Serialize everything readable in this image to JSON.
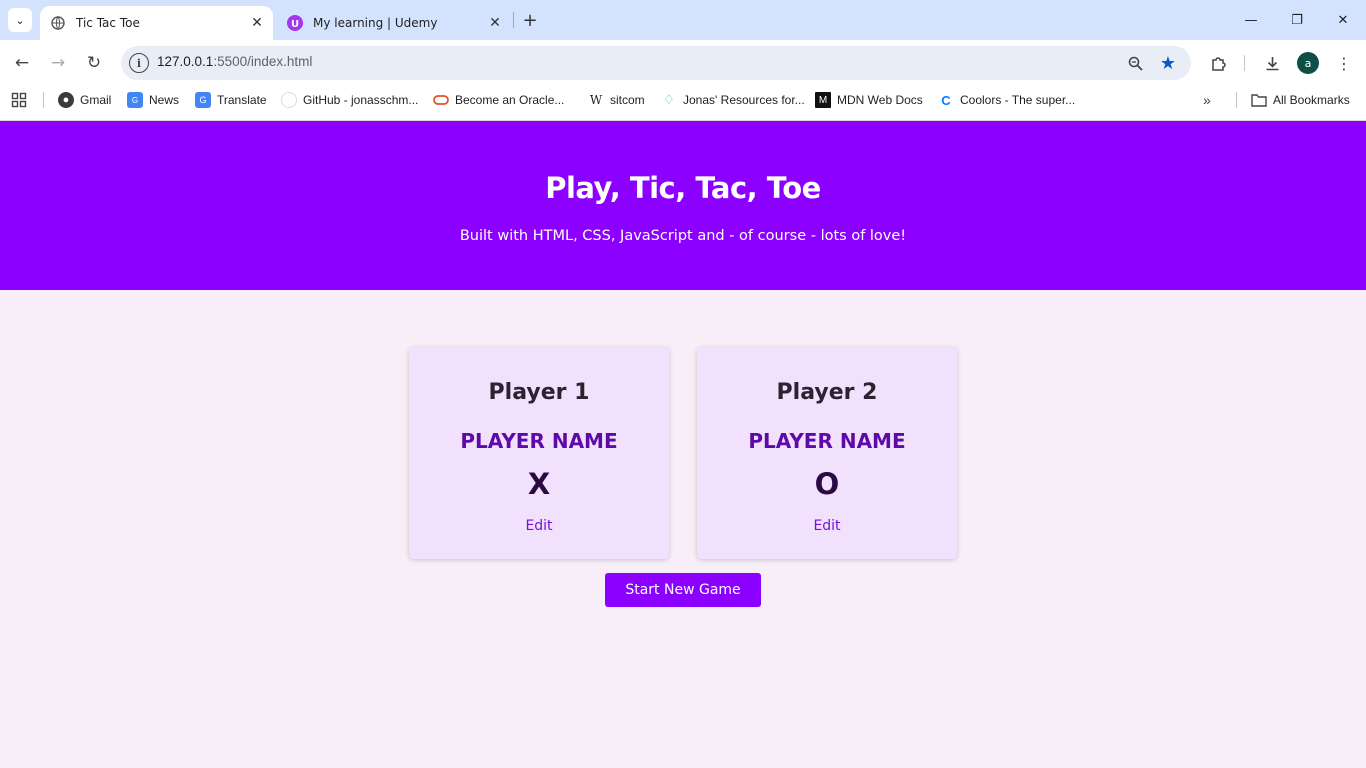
{
  "browser": {
    "tabs": [
      {
        "title": "Tic Tac Toe",
        "active": true
      },
      {
        "title": "My learning | Udemy",
        "active": false
      }
    ],
    "url": {
      "host": "127.0.0.1",
      "rest": ":5500/index.html"
    },
    "bookmarks": [
      {
        "label": "Gmail",
        "icon": "globe-icon"
      },
      {
        "label": "News",
        "icon": "news-icon"
      },
      {
        "label": "Translate",
        "icon": "translate-icon"
      },
      {
        "label": "GitHub - jonasschm...",
        "icon": "github-icon"
      },
      {
        "label": "Become an Oracle...",
        "icon": "oracle-icon"
      },
      {
        "label": "sitcom",
        "icon": "wikipedia-icon"
      },
      {
        "label": "Jonas' Resources for...",
        "icon": "diamond-icon"
      },
      {
        "label": "MDN Web Docs",
        "icon": "mdn-icon"
      },
      {
        "label": "Coolors - The super...",
        "icon": "coolors-icon"
      }
    ],
    "all_bookmarks_label": "All Bookmarks",
    "profile_initial": "a"
  },
  "hero": {
    "title": "Play, Tic, Tac, Toe",
    "subtitle": "Built with HTML, CSS, JavaScript and - of course - lots of love!"
  },
  "players": [
    {
      "title": "Player 1",
      "name": "PLAYER NAME",
      "symbol": "X",
      "edit_label": "Edit"
    },
    {
      "title": "Player 2",
      "name": "PLAYER NAME",
      "symbol": "O",
      "edit_label": "Edit"
    }
  ],
  "start_button_label": "Start New Game",
  "colors": {
    "accent": "#8c00ff",
    "card_bg": "#f2e1fc",
    "player_name": "#5d0aa8",
    "page_bg": "#f7eef7"
  }
}
